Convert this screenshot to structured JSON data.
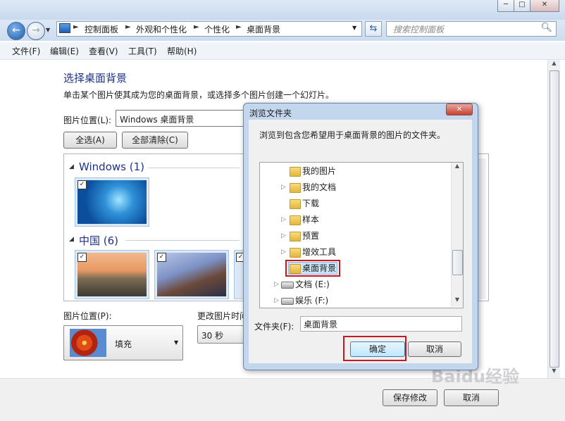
{
  "window": {
    "minimize_glyph": "─",
    "maximize_glyph": "□",
    "close_glyph": "✕"
  },
  "address_bar": {
    "crumbs": [
      "控制面板",
      "外观和个性化",
      "个性化",
      "桌面背景"
    ],
    "search_placeholder": "搜索控制面板"
  },
  "menu": [
    "文件(F)",
    "编辑(E)",
    "查看(V)",
    "工具(T)",
    "帮助(H)"
  ],
  "main": {
    "heading": "选择桌面背景",
    "description": "单击某个图片使其成为您的桌面背景，或选择多个图片创建一个幻灯片。",
    "location_label": "图片位置(L):",
    "location_value": "Windows 桌面背景",
    "select_all": "全选(A)",
    "clear_all": "全部清除(C)",
    "groups": [
      {
        "name": "Windows (1)"
      },
      {
        "name": "中国 (6)"
      }
    ],
    "picture_position_label": "图片位置(P):",
    "picture_position_value": "填充",
    "change_interval_label": "更改图片时间",
    "interval_value": "30 秒"
  },
  "footer": {
    "save": "保存修改",
    "cancel": "取消"
  },
  "dialog": {
    "title": "浏览文件夹",
    "close_glyph": "✕",
    "instruction": "浏览到包含您希望用于桌面背景的图片的文件夹。",
    "tree": [
      {
        "label": "我的图片",
        "kind": "folder",
        "expander": ""
      },
      {
        "label": "我的文档",
        "kind": "folder",
        "expander": "▷"
      },
      {
        "label": "下载",
        "kind": "folder",
        "expander": ""
      },
      {
        "label": "样本",
        "kind": "folder",
        "expander": "▷"
      },
      {
        "label": "预置",
        "kind": "folder",
        "expander": "▷"
      },
      {
        "label": "增效工具",
        "kind": "folder",
        "expander": "▷"
      },
      {
        "label": "桌面背景",
        "kind": "folder",
        "expander": ""
      },
      {
        "label": "文档 (E:)",
        "kind": "drive",
        "expander": "▷"
      },
      {
        "label": "娱乐 (F:)",
        "kind": "drive",
        "expander": "▷"
      }
    ],
    "folder_label": "文件夹(F):",
    "folder_value": "桌面背景",
    "ok": "确定",
    "cancel": "取消"
  },
  "watermark": "Baidu经验"
}
